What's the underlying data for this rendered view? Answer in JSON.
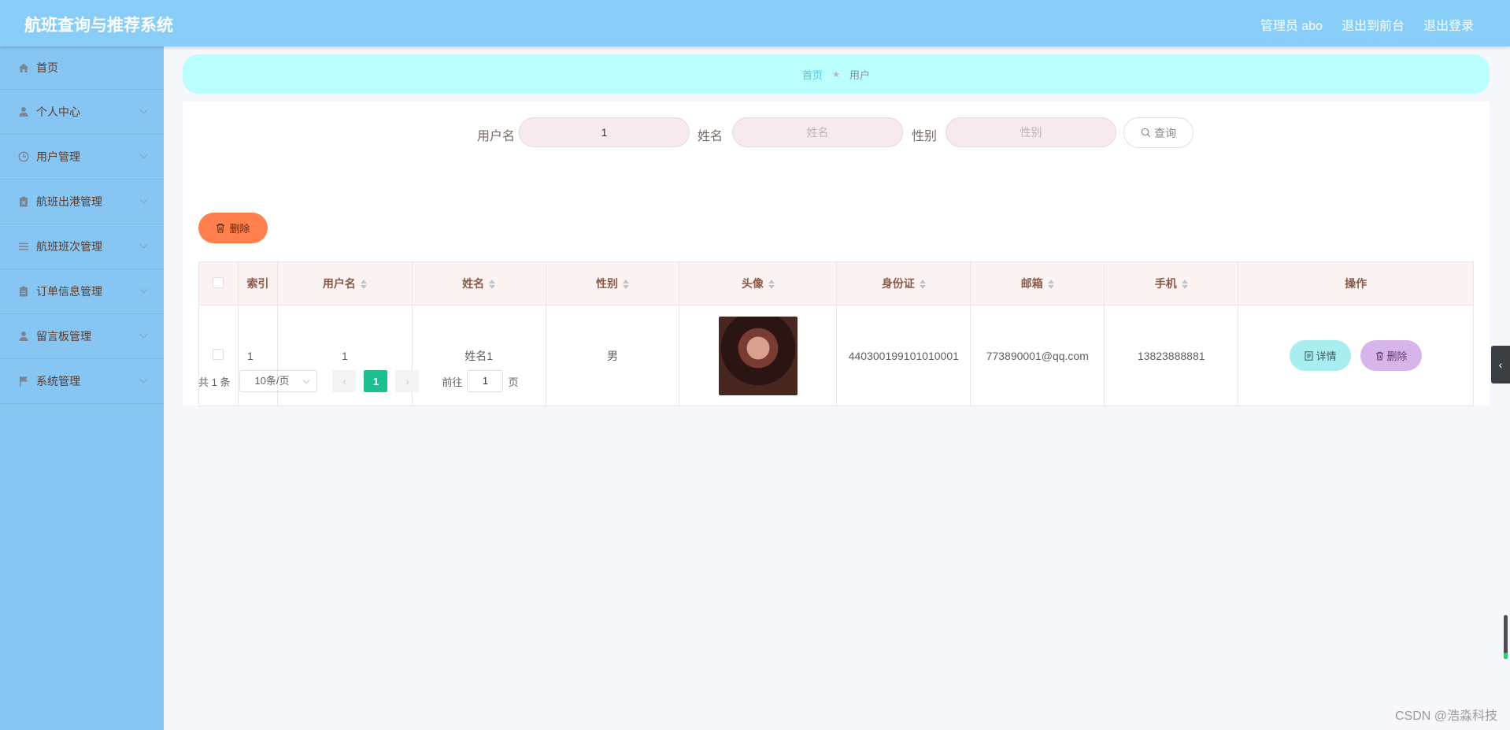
{
  "app": {
    "title": "航班查询与推荐系统"
  },
  "header": {
    "admin": "管理员 abo",
    "to_front": "退出到前台",
    "logout": "退出登录"
  },
  "sidebar": {
    "items": [
      {
        "label": "首页",
        "icon": "home-icon"
      },
      {
        "label": "个人中心",
        "icon": "user-icon"
      },
      {
        "label": "用户管理",
        "icon": "clock-icon"
      },
      {
        "label": "航班出港管理",
        "icon": "clipboard-x-icon"
      },
      {
        "label": "航班班次管理",
        "icon": "list-icon"
      },
      {
        "label": "订单信息管理",
        "icon": "clipboard-icon"
      },
      {
        "label": "留言板管理",
        "icon": "user-icon"
      },
      {
        "label": "系统管理",
        "icon": "flag-icon"
      }
    ]
  },
  "breadcrumb": {
    "home": "首页",
    "current": "用户"
  },
  "search": {
    "username_label": "用户名",
    "username_value": "1",
    "name_label": "姓名",
    "name_placeholder": "姓名",
    "gender_label": "性别",
    "gender_placeholder": "性别",
    "query_label": "查询"
  },
  "toolbar": {
    "delete_label": "删除"
  },
  "table": {
    "headers": {
      "index": "索引",
      "username": "用户名",
      "name": "姓名",
      "gender": "性别",
      "avatar": "头像",
      "idcard": "身份证",
      "email": "邮箱",
      "phone": "手机",
      "ops": "操作"
    },
    "rows": [
      {
        "index": "1",
        "username": "1",
        "name": "姓名1",
        "gender": "男",
        "idcard": "440300199101010001",
        "email": "773890001@qq.com",
        "phone": "13823888881",
        "detail_label": "详情",
        "delete_label": "删除"
      }
    ]
  },
  "pagination": {
    "total": "共 1 条",
    "page_size": "10条/页",
    "current_page": "1",
    "goto_prefix": "前往",
    "goto_value": "1",
    "goto_suffix": "页"
  },
  "watermark": "CSDN @浩淼科技",
  "colors": {
    "topbar": "#87cdf8",
    "sidebar": "#87c6f3",
    "breadcrumb": "#bbfefe",
    "delete": "#ff7f4d",
    "active_page": "#1cbf8f"
  }
}
